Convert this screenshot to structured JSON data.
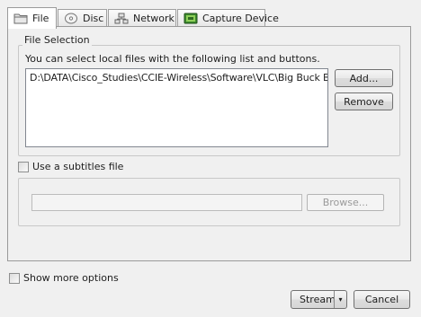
{
  "tabs": [
    {
      "label": "File",
      "icon": "folder-icon",
      "active": true
    },
    {
      "label": "Disc",
      "icon": "disc-icon",
      "active": false
    },
    {
      "label": "Network",
      "icon": "network-icon",
      "active": false
    },
    {
      "label": "Capture Device",
      "icon": "capture-device-icon",
      "active": false
    }
  ],
  "file_selection": {
    "title": "File Selection",
    "hint": "You can select local files with the following list and buttons.",
    "files": [
      "D:\\DATA\\Cisco_Studies\\CCIE-Wireless\\Software\\VLC\\Big Buck Bunn..."
    ],
    "add_label": "Add...",
    "remove_label": "Remove"
  },
  "subtitles": {
    "checkbox_label": "Use a subtitles file",
    "checked": false,
    "path_value": "",
    "browse_label": "Browse..."
  },
  "footer": {
    "more_options_label": "Show more options",
    "more_options_checked": false,
    "stream_label": "Stream",
    "stream_dropdown": "▾",
    "cancel_label": "Cancel"
  }
}
